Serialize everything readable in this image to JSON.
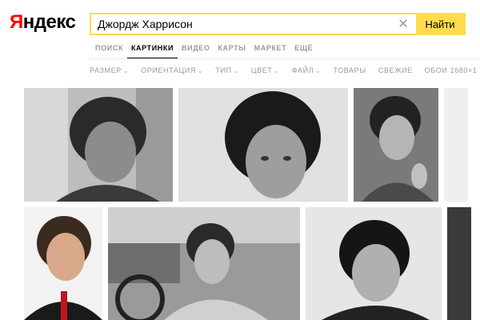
{
  "header": {
    "logo_first": "Я",
    "logo_rest": "ндекс",
    "search_value": "Джордж Харрисон",
    "search_button": "Найти",
    "clear_icon": "close-icon"
  },
  "services": [
    {
      "label": "ПОИСК",
      "active": false
    },
    {
      "label": "КАРТИНКИ",
      "active": true
    },
    {
      "label": "ВИДЕО",
      "active": false
    },
    {
      "label": "КАРТЫ",
      "active": false
    },
    {
      "label": "МАРКЕТ",
      "active": false
    },
    {
      "label": "ЕЩЁ",
      "active": false
    }
  ],
  "filters": [
    {
      "label": "РАЗМЕР",
      "dropdown": true
    },
    {
      "label": "ОРИЕНТАЦИЯ",
      "dropdown": true
    },
    {
      "label": "ТИП",
      "dropdown": true
    },
    {
      "label": "ЦВЕТ",
      "dropdown": true
    },
    {
      "label": "ФАЙЛ",
      "dropdown": true
    },
    {
      "label": "ТОВАРЫ",
      "dropdown": false
    },
    {
      "label": "СВЕЖИЕ",
      "dropdown": false
    },
    {
      "label": "ОБОИ 1680×1",
      "dropdown": false
    }
  ],
  "colors": {
    "accent": "#ffdb4d",
    "logo_red": "#ff0000",
    "muted": "#999999"
  }
}
